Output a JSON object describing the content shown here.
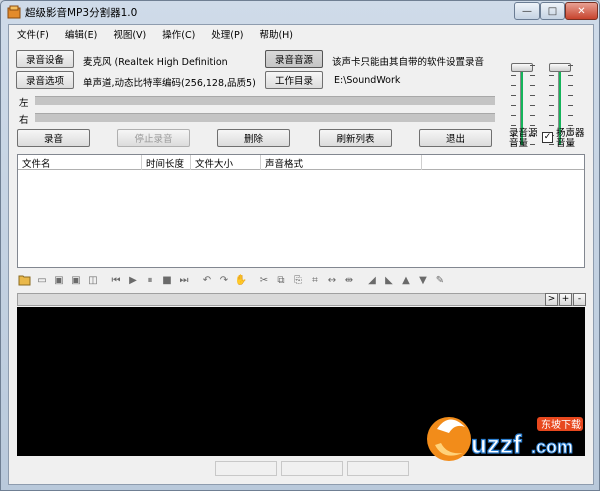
{
  "window": {
    "title": "超级影音MP3分割器1.0",
    "controls": {
      "minimize": "—",
      "maximize": "□",
      "close": "✕"
    }
  },
  "menu": [
    {
      "label": "文件(F)"
    },
    {
      "label": "编辑(E)"
    },
    {
      "label": "视图(V)"
    },
    {
      "label": "操作(C)"
    },
    {
      "label": "处理(P)"
    },
    {
      "label": "帮助(H)"
    }
  ],
  "record": {
    "device_button": "录音设备",
    "device_value": "麦克风 (Realtek High Definition",
    "options_button": "录音选项",
    "options_value": "单声道,动态比特率编码(256,128,品质5)",
    "source_button": "录音音源",
    "source_note": "该声卡只能由其自带的软件设置录音",
    "workdir_button": "工作目录",
    "workdir_value": "E:\\SoundWork",
    "left_label": "左",
    "right_label": "右"
  },
  "actions": {
    "record": "录音",
    "stop": "停止录音",
    "delete": "删除",
    "refresh": "刷新列表",
    "exit": "退出"
  },
  "volume": {
    "source_label_1": "录音源",
    "source_label_2": "音量",
    "speaker_label_1": "扬声器",
    "speaker_label_2": "音量",
    "speaker_checked": true,
    "check_mark": "✓"
  },
  "file_list": {
    "columns": [
      "文件名",
      "时间长度",
      "文件大小",
      "声音格式"
    ]
  },
  "scroll": {
    "right_arrow": ">",
    "plus": "+",
    "minus": "-"
  },
  "toolbar_icons": [
    "open-folder",
    "new-file",
    "save",
    "save-as",
    "save-selection",
    "go-start",
    "play",
    "pause",
    "stop",
    "go-end",
    "undo",
    "redo",
    "hand",
    "cut",
    "copy",
    "paste",
    "crop",
    "zoom-in",
    "zoom-out",
    "fade-in",
    "fade-out",
    "volume-up",
    "volume-down",
    "effects"
  ],
  "watermark": {
    "brand": "uzzf",
    "domain": ".com",
    "tag": "东坡下载"
  },
  "colors": {
    "accent_green": "#14b45a",
    "waveform_bg": "#000000",
    "close_red": "#c7432d"
  }
}
